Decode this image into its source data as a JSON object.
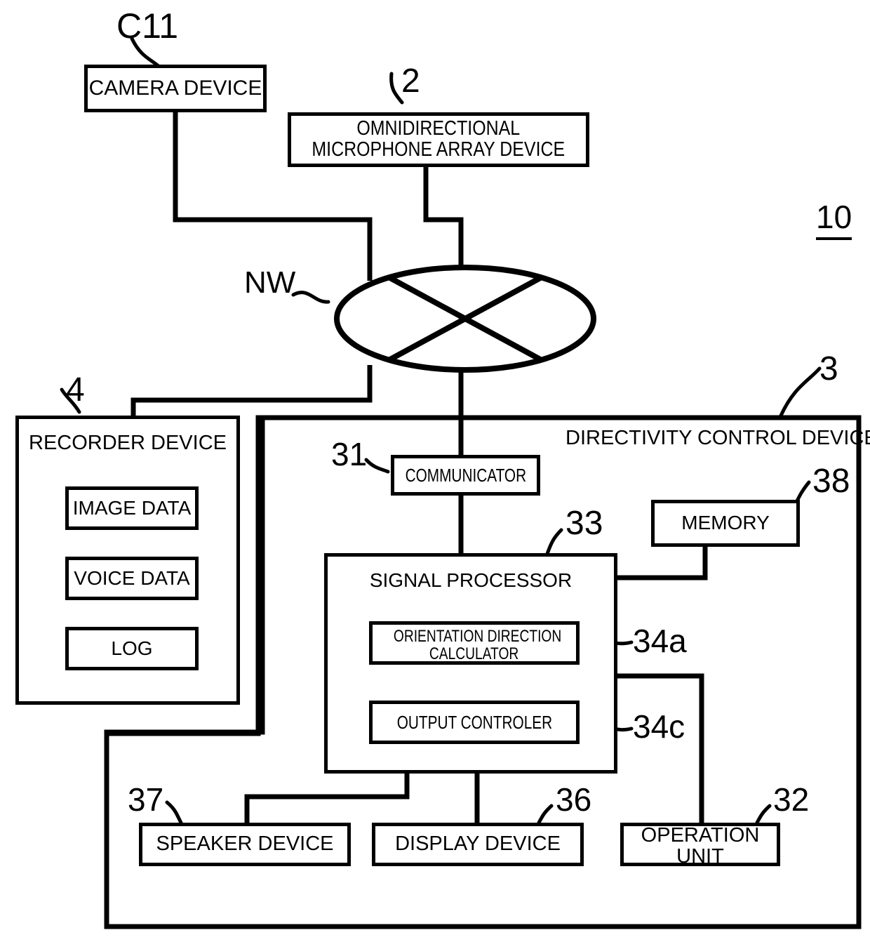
{
  "figure": {
    "system_ref": "10",
    "network_label": "NW"
  },
  "nodes": {
    "camera": {
      "label": "CAMERA DEVICE",
      "ref": "C11"
    },
    "mic_array": {
      "label": "OMNIDIRECTIONAL\nMICROPHONE ARRAY DEVICE",
      "ref": "2"
    },
    "recorder": {
      "label": "RECORDER DEVICE",
      "ref": "4"
    },
    "image_data": {
      "label": "IMAGE DATA"
    },
    "voice_data": {
      "label": "VOICE DATA"
    },
    "log": {
      "label": "LOG"
    },
    "directivity": {
      "label": "DIRECTIVITY CONTROL DEVICE",
      "ref": "3"
    },
    "communicator": {
      "label": "COMMUNICATOR",
      "ref": "31"
    },
    "memory": {
      "label": "MEMORY",
      "ref": "38"
    },
    "signal_processor": {
      "label": "SIGNAL PROCESSOR",
      "ref": "33"
    },
    "orientation_calc": {
      "label_line1": "ORIENTATION DIRECTION",
      "label_line2": "CALCULATOR",
      "ref": "34a"
    },
    "output_controller": {
      "label": "OUTPUT CONTROLER",
      "ref": "34c"
    },
    "speaker": {
      "label": "SPEAKER DEVICE",
      "ref": "37"
    },
    "display": {
      "label": "DISPLAY DEVICE",
      "ref": "36"
    },
    "operation_unit": {
      "label_line1": "OPERATION",
      "label_line2": "UNIT",
      "ref": "32"
    }
  },
  "colors": {
    "stroke": "#000000",
    "background": "#ffffff"
  }
}
